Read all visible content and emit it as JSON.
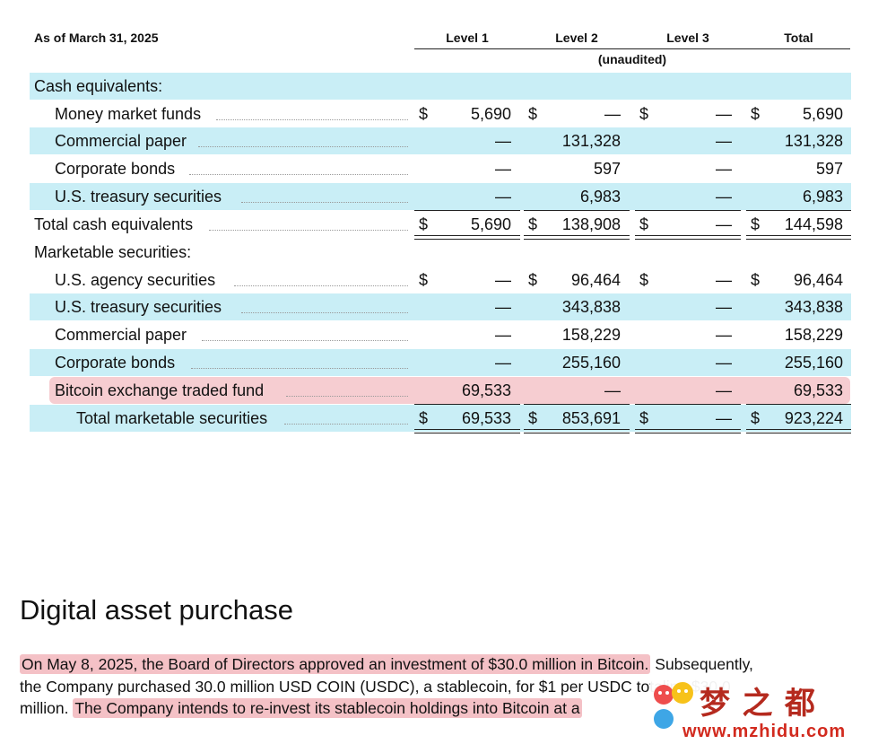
{
  "table": {
    "as_of": "As of March 31, 2025",
    "columns": [
      "Level 1",
      "Level 2",
      "Level 3",
      "Total"
    ],
    "unaudited": "(unaudited)",
    "dollar": "$",
    "rows": [
      {
        "label": "Cash equivalents:",
        "values": [
          "",
          "",
          "",
          ""
        ],
        "dollars": [
          false,
          false,
          false,
          false
        ]
      },
      {
        "label": "Money market funds",
        "values": [
          "5,690",
          "—",
          "—",
          "5,690"
        ],
        "dollars": [
          true,
          true,
          true,
          true
        ]
      },
      {
        "label": "Commercial paper",
        "values": [
          "—",
          "131,328",
          "—",
          "131,328"
        ],
        "dollars": [
          false,
          false,
          false,
          false
        ]
      },
      {
        "label": "Corporate bonds",
        "values": [
          "—",
          "597",
          "—",
          "597"
        ],
        "dollars": [
          false,
          false,
          false,
          false
        ]
      },
      {
        "label": "U.S. treasury securities",
        "values": [
          "—",
          "6,983",
          "—",
          "6,983"
        ],
        "dollars": [
          false,
          false,
          false,
          false
        ]
      },
      {
        "label": "Total cash equivalents",
        "values": [
          "5,690",
          "138,908",
          "—",
          "144,598"
        ],
        "dollars": [
          true,
          true,
          true,
          true
        ]
      },
      {
        "label": "Marketable securities:",
        "values": [
          "",
          "",
          "",
          ""
        ],
        "dollars": [
          false,
          false,
          false,
          false
        ]
      },
      {
        "label": "U.S. agency securities",
        "values": [
          "—",
          "96,464",
          "—",
          "96,464"
        ],
        "dollars": [
          true,
          true,
          true,
          true
        ]
      },
      {
        "label": "U.S. treasury securities",
        "values": [
          "—",
          "343,838",
          "—",
          "343,838"
        ],
        "dollars": [
          false,
          false,
          false,
          false
        ]
      },
      {
        "label": "Commercial paper",
        "values": [
          "—",
          "158,229",
          "—",
          "158,229"
        ],
        "dollars": [
          false,
          false,
          false,
          false
        ]
      },
      {
        "label": "Corporate bonds",
        "values": [
          "—",
          "255,160",
          "—",
          "255,160"
        ],
        "dollars": [
          false,
          false,
          false,
          false
        ]
      },
      {
        "label": "Bitcoin exchange traded fund",
        "values": [
          "69,533",
          "—",
          "—",
          "69,533"
        ],
        "dollars": [
          false,
          false,
          false,
          false
        ]
      },
      {
        "label": "Total marketable securities",
        "values": [
          "69,533",
          "853,691",
          "—",
          "923,224"
        ],
        "dollars": [
          true,
          true,
          true,
          true
        ]
      }
    ]
  },
  "section": {
    "heading": "Digital asset purchase",
    "line1_hl": "On May 8, 2025, the Board of Directors approved an investment of $30.0 million in Bitcoin.",
    "line1_rest": " Subsequently,",
    "line2": "the Company purchased 30.0 million USD COIN (USDC), a stablecoin, for $1 per USDC totaling $30.0",
    "line3_pre": "million. ",
    "line3_hl": "The Company intends to re-invest its stablecoin holdings into Bitcoin at a"
  },
  "watermark": {
    "text": "梦 之 都",
    "url": "www.mzhidu.com"
  }
}
